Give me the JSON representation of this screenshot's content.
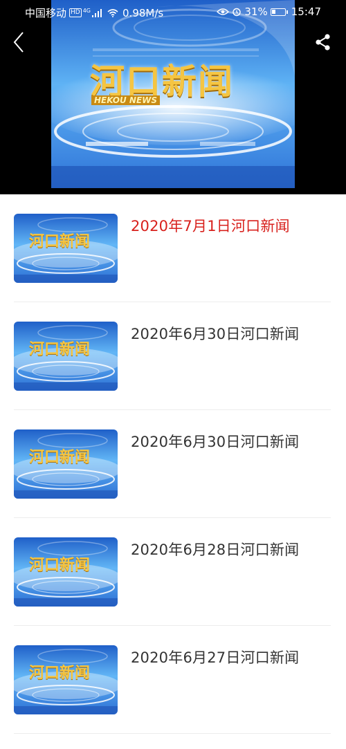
{
  "status_bar": {
    "carrier": "中国移动",
    "hd": "HD",
    "network": "4G",
    "speed": "0.98M/s",
    "battery": "31%",
    "battery_level": 0.31,
    "time": "15:47"
  },
  "player": {
    "logo_text": "河口新闻",
    "logo_subtext": "HEKOU NEWS"
  },
  "list": {
    "items": [
      {
        "title": "2020年7月1日河口新闻",
        "active": true
      },
      {
        "title": "2020年6月30日河口新闻",
        "active": false
      },
      {
        "title": "2020年6月30日河口新闻",
        "active": false
      },
      {
        "title": "2020年6月28日河口新闻",
        "active": false
      },
      {
        "title": "2020年6月27日河口新闻",
        "active": false
      }
    ]
  },
  "colors": {
    "active_title": "#d8201c",
    "title": "#333333",
    "logo_gold": "#f5c542",
    "sky_blue": "#3d8fe0"
  }
}
